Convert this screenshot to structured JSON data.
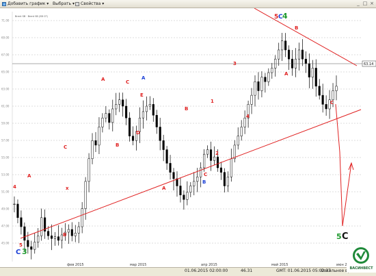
{
  "toolbar": {
    "add_chart_label": "Добавить график ▾",
    "select_label": "Выбрать ▾",
    "properties_label": "Свойства ▾"
  },
  "chart_header": "Brent SB  ·  Brent SB (SB CF)",
  "price_label": "63.14",
  "y_axis_ticks": [
    "71.00",
    "69.00",
    "67.00",
    "65.00",
    "63.00",
    "61.00",
    "59.00",
    "57.00",
    "55.00",
    "53.00",
    "51.00",
    "49.00",
    "47.00",
    "45.00"
  ],
  "x_axis_ticks": [
    "фев 2015",
    "мар 2015",
    "апр 2015",
    "май 2015",
    "июн 2"
  ],
  "wave_labels": [
    {
      "text": "4",
      "color": "#e02020"
    },
    {
      "text": "A",
      "color": "#e02020"
    },
    {
      "text": "x",
      "color": "#e02020"
    },
    {
      "text": "C",
      "color": "#e02020"
    },
    {
      "text": "B",
      "color": "#e02020"
    },
    {
      "text": "5",
      "color": "#e02020"
    },
    {
      "text": "A",
      "color": "#e02020"
    },
    {
      "text": "B",
      "color": "#e02020"
    },
    {
      "text": "C",
      "color": "#e02020"
    },
    {
      "text": "A",
      "color": "#1a3fd6"
    },
    {
      "text": "E",
      "color": "#e02020"
    },
    {
      "text": "D",
      "color": "#e02020"
    },
    {
      "text": "A",
      "color": "#e02020"
    },
    {
      "text": "B",
      "color": "#e02020"
    },
    {
      "text": "C",
      "color": "#e02020"
    },
    {
      "text": "B",
      "color": "#1a3fd6"
    },
    {
      "text": "1",
      "color": "#e02020"
    },
    {
      "text": "2",
      "color": "#e02020"
    },
    {
      "text": "3",
      "color": "#e02020"
    },
    {
      "text": "4",
      "color": "#e02020"
    },
    {
      "text": "A",
      "color": "#e02020"
    },
    {
      "text": "B",
      "color": "#e02020"
    },
    {
      "text": "C",
      "color": "#e02020"
    }
  ],
  "big_labels": {
    "bottom_left_c": "C",
    "bottom_left_3": "3",
    "top_5": "5",
    "top_c": "C",
    "top_4": "4",
    "target_5": "5",
    "target_c": "C"
  },
  "colors": {
    "bull_red": "#e02020",
    "wave_blue": "#1a3fd6",
    "wave_green": "#1f9a2f",
    "dark": "#111111",
    "accent_line": "#e02020"
  },
  "status": {
    "date_time": "01.06.2015 02:00:00",
    "value": "46.31",
    "gmt_label": "GMT: 01.06.2015 05:02:37",
    "local_label": "Локальное вре"
  },
  "logo": {
    "text": "ВАСИНВЕСТ"
  },
  "chart_data": {
    "type": "candlestick",
    "x_start": "2015-01-13",
    "x_end": "2015-06-01",
    "ylim": [
      44.5,
      72
    ],
    "close_series_approx": [
      51.0,
      49.5,
      48.5,
      47.0,
      46.3,
      46.0,
      46.8,
      47.5,
      49.5,
      48.0,
      47.5,
      47.2,
      47.4,
      47.0,
      47.6,
      47.9,
      48.2,
      47.5,
      47.8,
      48.5,
      50.5,
      53.5,
      56.0,
      58.0,
      57.5,
      59.5,
      60.5,
      61.0,
      60.0,
      61.5,
      62.0,
      62.5,
      61.8,
      60.5,
      58.5,
      58.0,
      59.0,
      60.5,
      61.2,
      61.8,
      62.0,
      60.8,
      59.5,
      58.0,
      57.0,
      55.5,
      54.5,
      53.8,
      53.0,
      52.0,
      51.5,
      52.3,
      53.0,
      53.5,
      54.0,
      55.0,
      56.5,
      57.0,
      55.8,
      56.2,
      55.0,
      54.5,
      53.0,
      54.0,
      56.0,
      57.5,
      58.5,
      59.5,
      60.5,
      62.0,
      63.0,
      64.5,
      63.5,
      65.0,
      64.5,
      65.5,
      66.0,
      67.0,
      68.0,
      69.0,
      68.0,
      67.0,
      66.0,
      67.0,
      68.0,
      67.0,
      66.5,
      65.0,
      66.0,
      64.0,
      63.0,
      62.0,
      61.5,
      62.5,
      63.5,
      64.0
    ]
  }
}
